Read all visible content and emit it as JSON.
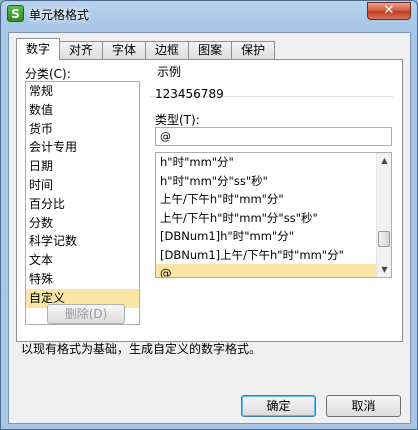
{
  "window": {
    "title": "单元格格式",
    "close_label": "✕",
    "app_icon_letter": "S"
  },
  "tabs": [
    {
      "label": "数字",
      "active": true
    },
    {
      "label": "对齐",
      "active": false
    },
    {
      "label": "字体",
      "active": false
    },
    {
      "label": "边框",
      "active": false
    },
    {
      "label": "图案",
      "active": false
    },
    {
      "label": "保护",
      "active": false
    }
  ],
  "category": {
    "label": "分类(C):",
    "items": [
      "常规",
      "数值",
      "货币",
      "会计专用",
      "日期",
      "时间",
      "百分比",
      "分数",
      "科学记数",
      "文本",
      "特殊",
      "自定义"
    ],
    "selected_index": 11
  },
  "sample": {
    "label": "示例",
    "value": "123456789"
  },
  "type": {
    "label": "类型(T):",
    "value": "@",
    "items": [
      "h\"时\"mm\"分\"",
      "h\"时\"mm\"分\"ss\"秒\"",
      "上午/下午h\"时\"mm\"分\"",
      "上午/下午h\"时\"mm\"分\"ss\"秒\"",
      "[DBNum1]h\"时\"mm\"分\"",
      "[DBNum1]上午/下午h\"时\"mm\"分\"",
      "@"
    ],
    "selected_index": 6
  },
  "buttons": {
    "delete": "删除(D)",
    "ok": "确定",
    "cancel": "取消"
  },
  "description": "以现有格式为基础，生成自定义的数字格式。"
}
